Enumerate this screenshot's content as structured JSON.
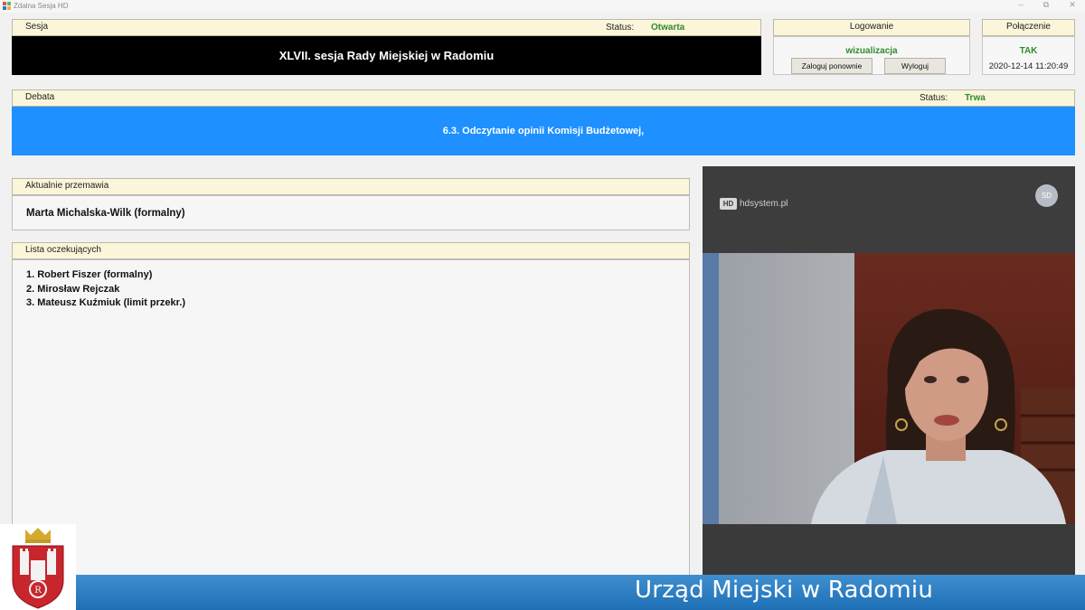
{
  "window": {
    "title": "Zdalna Sesja HD",
    "icon": "app-icon",
    "controls": [
      "–",
      "⧉",
      "✕"
    ]
  },
  "sesja": {
    "header": "Sesja",
    "status_label": "Status:",
    "status_value": "Otwarta",
    "title": "XLVII. sesja Rady Miejskiej w Radomiu"
  },
  "logowanie": {
    "header": "Logowanie",
    "user": "wizualizacja",
    "relogin_label": "Zaloguj ponownie",
    "logout_label": "Wyloguj"
  },
  "polaczenie": {
    "header": "Połączenie",
    "value": "TAK",
    "datetime": "2020-12-14 11:20:49"
  },
  "debata": {
    "header": "Debata",
    "status_label": "Status:",
    "status_value": "Trwa",
    "topic": "6.3. Odczytanie opinii Komisji Budżetowej,"
  },
  "current_speaker": {
    "header": "Aktualnie przemawia",
    "name": "Marta Michalska-Wilk (formalny)"
  },
  "queue": {
    "header": "Lista oczekujących",
    "items": [
      "1. Robert Fiszer (formalny)",
      "2. Mirosław Rejczak",
      "3. Mateusz Kuźmiuk (limit przekr.)"
    ]
  },
  "video": {
    "brand": "hdsystem.pl",
    "brand_mark": "HD",
    "avatar_initials": "SD"
  },
  "banner": {
    "text": "Urząd Miejski w Radomiu"
  },
  "colors": {
    "accent_blue": "#1e90ff",
    "status_green": "#2e8b2e",
    "header_bg": "#fbf5da",
    "banner_blue": "#1e6fb4"
  }
}
